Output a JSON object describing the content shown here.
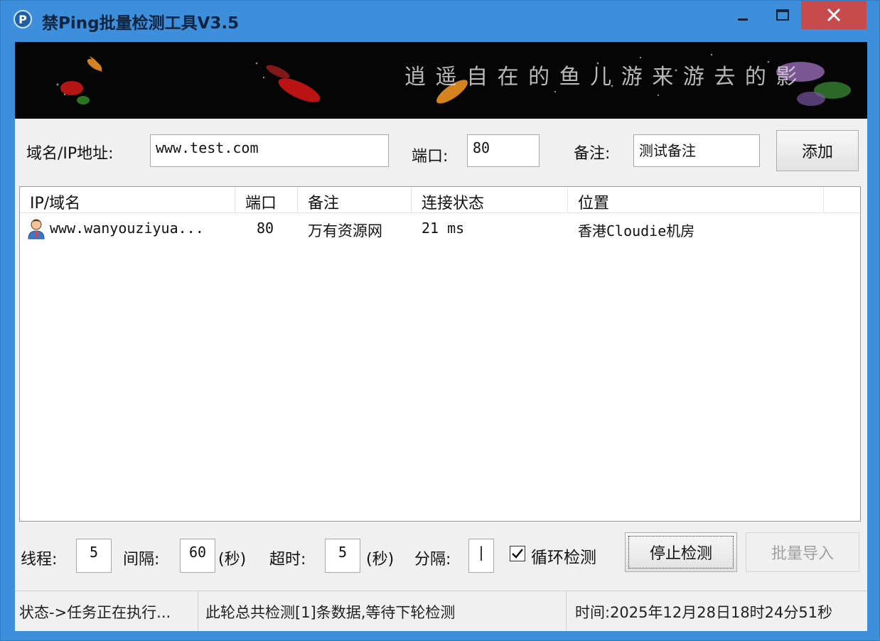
{
  "window": {
    "title": "禁Ping批量检测工具V3.5",
    "icon": "app-p-icon",
    "controls": [
      "minimize-icon",
      "maximize-icon",
      "close-icon"
    ],
    "accent": "#3d8fdc",
    "close_color": "#c74a4d"
  },
  "banner": {
    "calligraphy": "逍 遥 自 在 的 鱼 儿 游 来 游 去 的 影"
  },
  "form": {
    "domain_label": "域名/IP地址:",
    "domain_value": "www.test.com",
    "port_label": "端口:",
    "port_value": "80",
    "note_label": "备注:",
    "note_value": "测试备注",
    "add_button": "添加"
  },
  "list": {
    "columns": [
      "IP/域名",
      "端口",
      "备注",
      "连接状态",
      "位置"
    ],
    "rows": [
      {
        "icon": "user-icon",
        "host": "www.wanyouziyua...",
        "port": "80",
        "note": "万有资源网",
        "status": "21 ms",
        "location": "香港Cloudie机房"
      }
    ]
  },
  "settings": {
    "threads_label": "线程:",
    "threads_value": "5",
    "interval_label": "间隔:",
    "interval_value": "60",
    "interval_unit": "(秒)",
    "timeout_label": "超时:",
    "timeout_value": "5",
    "timeout_unit": "(秒)",
    "separator_label": "分隔:",
    "separator_value": "|",
    "loop_label": "循环检测",
    "loop_checked": true,
    "stop_button": "停止检测",
    "import_button": "批量导入"
  },
  "status": {
    "state": "状态->任务正在执行...",
    "message": "此轮总共检测[1]条数据,等待下轮检测",
    "time": "时间:2025年12月28日18时24分51秒"
  }
}
